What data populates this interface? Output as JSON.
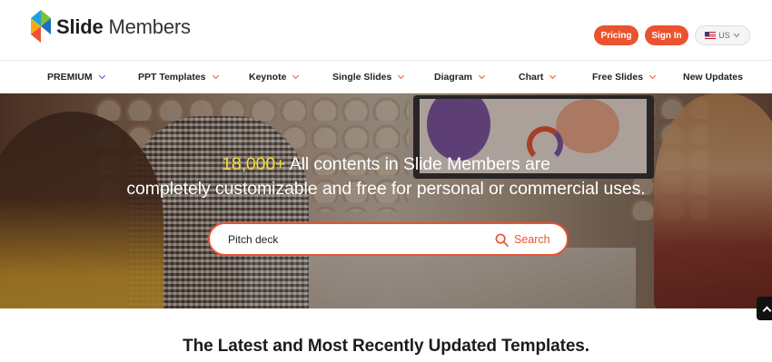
{
  "brand": {
    "name_bold": "Slide",
    "name_light": "Members",
    "colors": {
      "accent": "#e9532f",
      "nav_chevron_premium": "#3a57c4",
      "highlight": "#f5dd3c"
    }
  },
  "header": {
    "pricing_label": "Pricing",
    "signin_label": "Sign In",
    "language_label": "US",
    "language_icon": "us-flag-icon"
  },
  "nav": {
    "items": [
      {
        "label": "PREMIUM",
        "has_dropdown": true
      },
      {
        "label": "PPT Templates",
        "has_dropdown": true
      },
      {
        "label": "Keynote",
        "has_dropdown": true
      },
      {
        "label": "Single Slides",
        "has_dropdown": true
      },
      {
        "label": "Diagram",
        "has_dropdown": true
      },
      {
        "label": "Chart",
        "has_dropdown": true
      },
      {
        "label": "Free Slides",
        "has_dropdown": true
      },
      {
        "label": "New Updates",
        "has_dropdown": false
      }
    ]
  },
  "hero": {
    "count": "18,000+",
    "line1_rest": " All contents in Slide Members are",
    "line2": "completely customizable and free for personal or commercial uses.",
    "search": {
      "value": "Pitch deck",
      "button_label": "Search",
      "icon": "search-icon"
    }
  },
  "section": {
    "title": "The Latest and Most Recently Updated Templates."
  },
  "scroll_top_icon": "chevron-up-icon"
}
